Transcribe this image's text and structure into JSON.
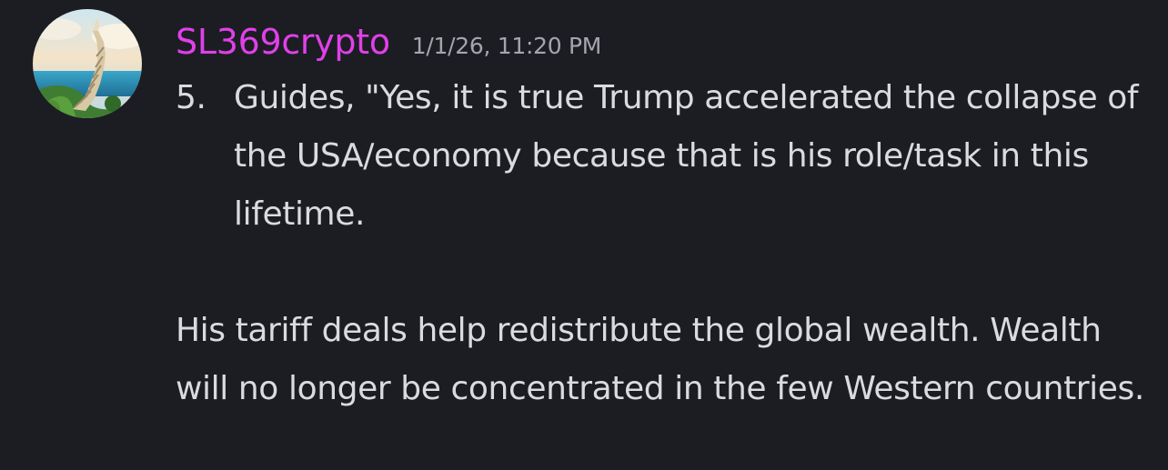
{
  "message": {
    "author": "SL369crypto",
    "timestamp": "1/1/26, 11:20 PM",
    "list_marker": "5.",
    "list_item": "Guides, \"Yes, it is true Trump accelerated the collapse of the USA/economy because that is his role/task in this lifetime.",
    "paragraph": "His tariff deals help redistribute the global wealth. Wealth will no longer be concentrated in the few Western countries.",
    "author_color": "#e040ea"
  }
}
